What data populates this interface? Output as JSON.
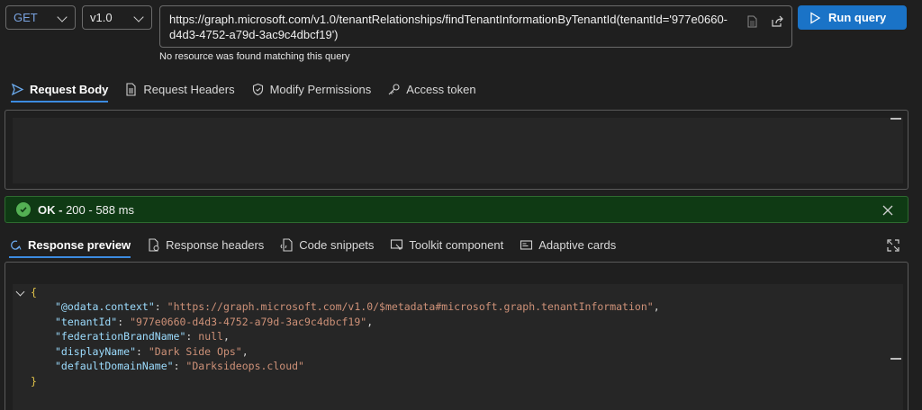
{
  "toolbar": {
    "method": "GET",
    "version": "v1.0",
    "url": "https://graph.microsoft.com/v1.0/tenantRelationships/findTenantInformationByTenantId(tenantId='977e0660-d4d3-4752-a79d-3ac9c4dbcf19')",
    "run_label": "Run query",
    "url_message": "No resource was found matching this query"
  },
  "request_tabs": [
    {
      "label": "Request Body",
      "icon": "send-icon",
      "active": true
    },
    {
      "label": "Request Headers",
      "icon": "document-icon"
    },
    {
      "label": "Modify Permissions",
      "icon": "shield-icon"
    },
    {
      "label": "Access token",
      "icon": "key-icon"
    }
  ],
  "status": {
    "label": "OK -",
    "detail": "200 - 588 ms",
    "color": "#0f3a14"
  },
  "response_tabs": [
    {
      "label": "Response preview",
      "icon": "preview-icon",
      "active": true
    },
    {
      "label": "Response headers",
      "icon": "headers-icon"
    },
    {
      "label": "Code snippets",
      "icon": "code-icon"
    },
    {
      "label": "Toolkit component",
      "icon": "toolkit-icon"
    },
    {
      "label": "Adaptive cards",
      "icon": "card-icon"
    }
  ],
  "response_json": {
    "open_brace": "{",
    "close_brace": "}",
    "lines": [
      {
        "key": "\"@odata.context\"",
        "value": "\"https://graph.microsoft.com/v1.0/$metadata#microsoft.graph.tenantInformation\"",
        "sep": ","
      },
      {
        "key": "\"tenantId\"",
        "value": "\"977e0660-d4d3-4752-a79d-3ac9c4dbcf19\"",
        "sep": ","
      },
      {
        "key": "\"federationBrandName\"",
        "value": "null",
        "sep": ","
      },
      {
        "key": "\"displayName\"",
        "value": "\"Dark Side Ops\"",
        "sep": ","
      },
      {
        "key": "\"defaultDomainName\"",
        "value": "\"Darksideops.cloud\"",
        "sep": ""
      }
    ]
  },
  "colors": {
    "accent": "#1a73c7",
    "json_key": "#9cdcfe",
    "json_string": "#ce9178"
  }
}
